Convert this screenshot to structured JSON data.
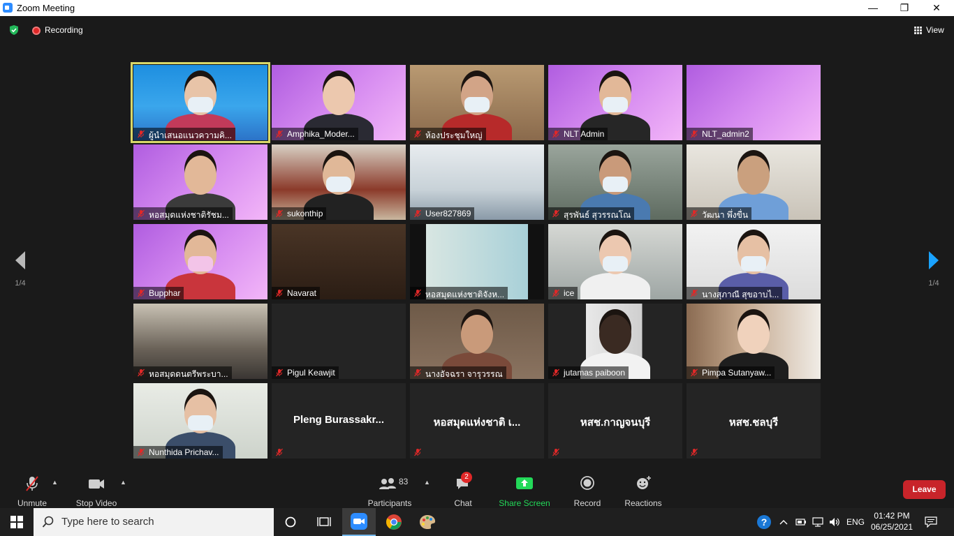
{
  "window": {
    "title": "Zoom Meeting",
    "controls": [
      "—",
      "❐",
      "✕"
    ]
  },
  "topbar": {
    "recording_label": "Recording",
    "view_label": "View"
  },
  "pagination": {
    "left": "1/4",
    "right": "1/4"
  },
  "participants": [
    {
      "name": "ผู้นำเสนอแนวความคิ...",
      "video": true,
      "active": true
    },
    {
      "name": "Amphika_Moder...",
      "video": true
    },
    {
      "name": "ห้องประชุมใหญ่",
      "video": true
    },
    {
      "name": "NLT Admin",
      "video": true
    },
    {
      "name": "NLT_admin2",
      "video": true
    },
    {
      "name": "หอสมุดแห่งชาติรัชม...",
      "video": true
    },
    {
      "name": "sukonthip",
      "video": true
    },
    {
      "name": "User827869",
      "video": true
    },
    {
      "name": "สุรพันธ์ สุวรรณโณ",
      "video": true
    },
    {
      "name": "วัฒนา พึ่งขื่น",
      "video": true
    },
    {
      "name": "Bupphar",
      "video": true
    },
    {
      "name": "Navarat",
      "video": true
    },
    {
      "name": "หอสมุดแห่งชาติจังห...",
      "video": true
    },
    {
      "name": "ice",
      "video": true
    },
    {
      "name": "นางสุภาณี สุขอาบไ...",
      "video": true
    },
    {
      "name": "หอสมุดดนตรีพระบา...",
      "video": true
    },
    {
      "name": "Pigul Keawjit",
      "video": false,
      "show_label": true
    },
    {
      "name": "นางอัจฉรา จารุวรรณ",
      "video": true
    },
    {
      "name": "jutamas paiboon",
      "video": true
    },
    {
      "name": "Pimpa Sutanyaw...",
      "video": true
    },
    {
      "name": "Nunthida Prichav...",
      "video": true
    },
    {
      "name": "Pleng  Burassakr...",
      "video": false
    },
    {
      "name": "หอสมุดแห่งชาติ เ...",
      "video": false
    },
    {
      "name": "หสช.กาญจนบุรี",
      "video": false
    },
    {
      "name": "หสช.ชลบุรี",
      "video": false
    }
  ],
  "toolbar": {
    "unmute": "Unmute",
    "stop_video": "Stop Video",
    "participants_label": "Participants",
    "participants_count": "83",
    "chat": "Chat",
    "chat_badge": "2",
    "share_screen": "Share Screen",
    "record": "Record",
    "reactions": "Reactions",
    "leave": "Leave"
  },
  "taskbar": {
    "search_placeholder": "Type here to search",
    "language": "ENG",
    "time": "01:42 PM",
    "date": "06/25/2021"
  },
  "colors": {
    "share_green": "#23d959",
    "leave_red": "#c8242a",
    "active_speaker": "#d8d86a",
    "muted_red": "#e02828"
  }
}
